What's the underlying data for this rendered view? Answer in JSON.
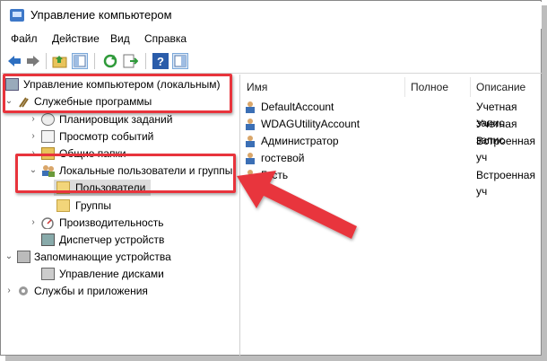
{
  "window": {
    "title": "Управление компьютером"
  },
  "menu": [
    "Файл",
    "Действие",
    "Вид",
    "Справка"
  ],
  "tree": {
    "root": "Управление компьютером (локальным)",
    "system_tools": "Служебные программы",
    "task_scheduler": "Планировщик заданий",
    "event_viewer": "Просмотр событий",
    "shared_folders": "Общие папки",
    "local_users": "Локальные пользователи и группы",
    "users": "Пользователи",
    "groups": "Группы",
    "performance": "Производительность",
    "device_manager": "Диспетчер устройств",
    "storage": "Запоминающие устройства",
    "disk_management": "Управление дисками",
    "services": "Службы и приложения"
  },
  "list": {
    "columns": {
      "name": "Имя",
      "full": "Полное",
      "desc": "Описание"
    },
    "rows": [
      {
        "name": "DefaultAccount",
        "full": "",
        "desc": "Учетная запис"
      },
      {
        "name": "WDAGUtilityAccount",
        "full": "",
        "desc": "Учетная запис"
      },
      {
        "name": "Администратор",
        "full": "",
        "desc": "Встроенная уч"
      },
      {
        "name": "гостевой",
        "full": "",
        "desc": ""
      },
      {
        "name": "Гость",
        "full": "",
        "desc": "Встроенная уч"
      }
    ]
  },
  "colors": {
    "highlight": "#e8343c",
    "selected_bg": "#dcdcdc"
  }
}
